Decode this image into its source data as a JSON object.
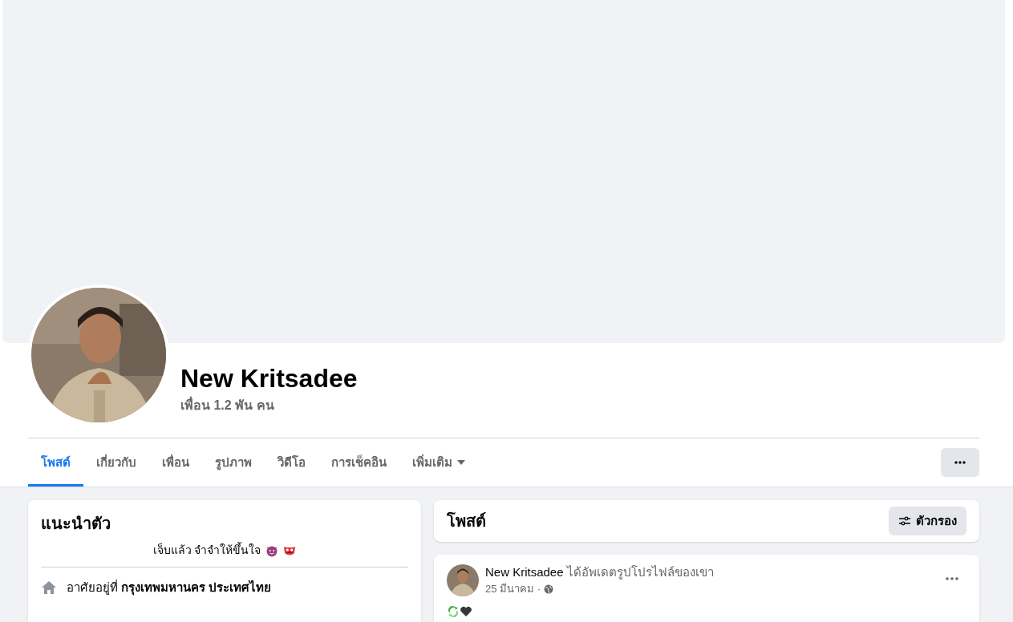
{
  "profile": {
    "name": "New Kritsadee",
    "friends": "เพื่อน 1.2 พัน คน"
  },
  "tabs": [
    {
      "label": "โพสต์",
      "selected": true,
      "dropdown": false
    },
    {
      "label": "เกี่ยวกับ",
      "selected": false,
      "dropdown": false
    },
    {
      "label": "เพื่อน",
      "selected": false,
      "dropdown": false
    },
    {
      "label": "รูปภาพ",
      "selected": false,
      "dropdown": false
    },
    {
      "label": "วิดีโอ",
      "selected": false,
      "dropdown": false
    },
    {
      "label": "การเช็คอิน",
      "selected": false,
      "dropdown": false
    },
    {
      "label": "เพิ่มเติม",
      "selected": false,
      "dropdown": true
    }
  ],
  "intro": {
    "title": "แนะนำตัว",
    "bio": "เจ็บแล้ว จำจำให้ขึ้นใจ",
    "details": [
      "อาศัยอยู่ที่ **กรุงเทพมหานคร ประเทศไทย**"
    ]
  },
  "posts_header": {
    "title": "โพสต์",
    "filter_button": "ตัวกรอง"
  },
  "post": {
    "author": "New Kritsadee",
    "action": "ได้อัพเดตรูปโปรไฟล์ของเขา",
    "date": "25 มีนาคม ·"
  }
}
